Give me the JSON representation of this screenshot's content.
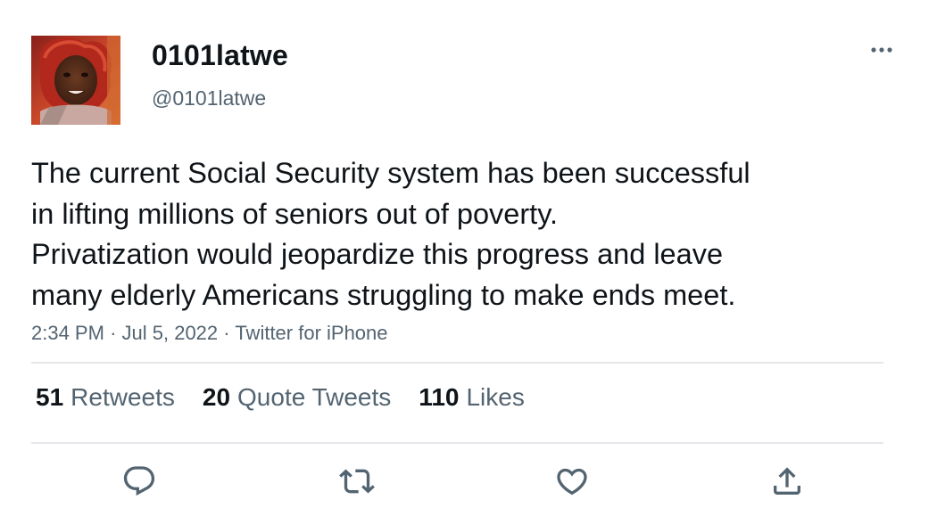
{
  "user": {
    "display_name": "0101latwe",
    "handle": "@0101latwe"
  },
  "tweet": {
    "text_lines": [
      "The current Social Security system has been successful",
      "in lifting millions of seniors out of poverty.",
      "Privatization would jeopardize this progress and leave",
      "many elderly Americans struggling to make ends meet."
    ],
    "time": "2:34 PM",
    "date": "Jul 5, 2022",
    "source": "Twitter for iPhone",
    "separator": "·"
  },
  "stats": {
    "retweets": {
      "count": "51",
      "label": "Retweets"
    },
    "quote_tweets": {
      "count": "20",
      "label": "Quote Tweets"
    },
    "likes": {
      "count": "110",
      "label": "Likes"
    }
  },
  "icons": {
    "more": "more-horizontal-icon",
    "reply": "reply-icon",
    "retweet": "retweet-icon",
    "like": "heart-icon",
    "share": "share-icon"
  },
  "colors": {
    "text_primary": "#0f1419",
    "text_secondary": "#536471",
    "divider": "#e5e7ea",
    "icon": "#536471"
  }
}
